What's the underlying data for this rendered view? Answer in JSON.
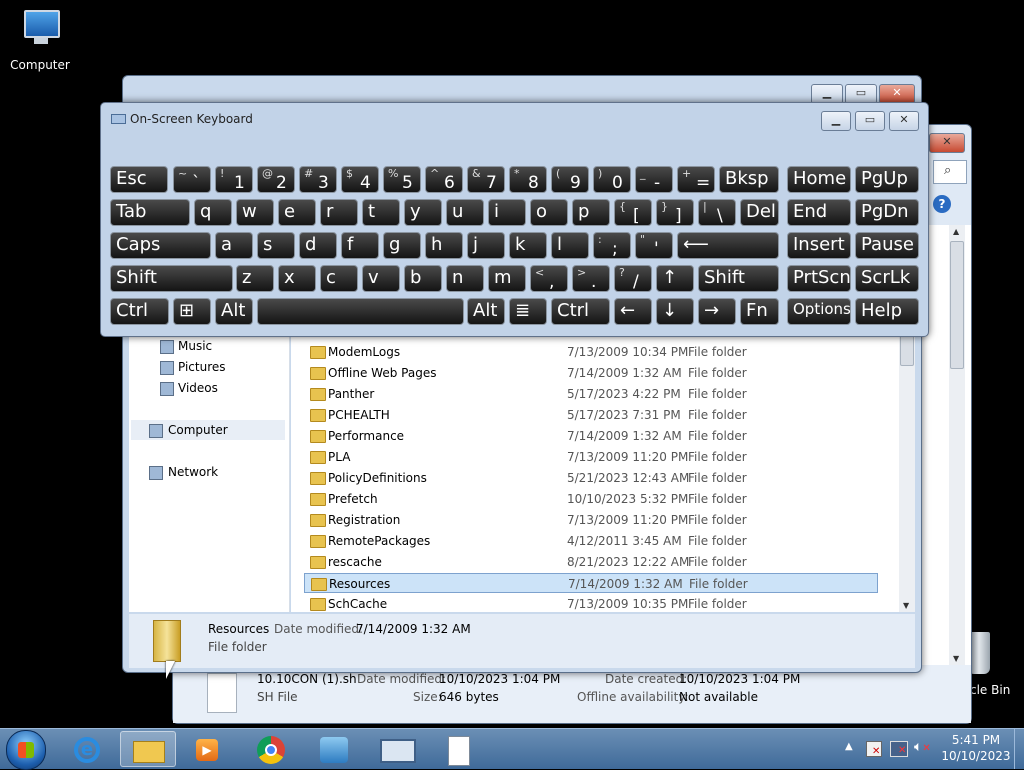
{
  "desktop": {
    "computer_label": "Computer",
    "recycle_label": "cle Bin"
  },
  "keyboard": {
    "title": "On-Screen Keyboard",
    "rows": [
      [
        {
          "k": "Esc"
        },
        {
          "s": "~",
          "m": "`"
        },
        {
          "s": "!",
          "m": "1"
        },
        {
          "s": "@",
          "m": "2"
        },
        {
          "s": "#",
          "m": "3"
        },
        {
          "s": "$",
          "m": "4"
        },
        {
          "s": "%",
          "m": "5"
        },
        {
          "s": "^",
          "m": "6"
        },
        {
          "s": "&",
          "m": "7"
        },
        {
          "s": "*",
          "m": "8"
        },
        {
          "s": "(",
          "m": "9"
        },
        {
          "s": ")",
          "m": "0"
        },
        {
          "s": "_",
          "m": "-"
        },
        {
          "s": "+",
          "m": "="
        },
        {
          "k": "Bksp"
        },
        {
          "k": "Home"
        },
        {
          "k": "PgUp"
        }
      ],
      [
        {
          "k": "Tab"
        },
        {
          "k": "q"
        },
        {
          "k": "w"
        },
        {
          "k": "e"
        },
        {
          "k": "r"
        },
        {
          "k": "t"
        },
        {
          "k": "y"
        },
        {
          "k": "u"
        },
        {
          "k": "i"
        },
        {
          "k": "o"
        },
        {
          "k": "p"
        },
        {
          "s": "{",
          "m": "["
        },
        {
          "s": "}",
          "m": "]"
        },
        {
          "s": "|",
          "m": "\\"
        },
        {
          "k": "Del"
        },
        {
          "k": "End"
        },
        {
          "k": "PgDn"
        }
      ],
      [
        {
          "k": "Caps"
        },
        {
          "k": "a"
        },
        {
          "k": "s"
        },
        {
          "k": "d"
        },
        {
          "k": "f"
        },
        {
          "k": "g"
        },
        {
          "k": "h"
        },
        {
          "k": "j"
        },
        {
          "k": "k"
        },
        {
          "k": "l"
        },
        {
          "s": ":",
          "m": ";"
        },
        {
          "s": "\"",
          "m": "'"
        },
        {
          "k": "⟵"
        },
        {
          "k": "Insert"
        },
        {
          "k": "Pause"
        }
      ],
      [
        {
          "k": "Shift"
        },
        {
          "k": "z"
        },
        {
          "k": "x"
        },
        {
          "k": "c"
        },
        {
          "k": "v"
        },
        {
          "k": "b"
        },
        {
          "k": "n"
        },
        {
          "k": "m"
        },
        {
          "s": "<",
          "m": ","
        },
        {
          "s": ">",
          "m": "."
        },
        {
          "s": "?",
          "m": "/"
        },
        {
          "k": "↑"
        },
        {
          "k": "Shift"
        },
        {
          "k": "PrtScn"
        },
        {
          "k": "ScrLk"
        }
      ],
      [
        {
          "k": "Ctrl"
        },
        {
          "k": "⊞"
        },
        {
          "k": "Alt"
        },
        {
          "k": ""
        },
        {
          "k": "Alt"
        },
        {
          "k": "≣"
        },
        {
          "k": "Ctrl"
        },
        {
          "k": "←"
        },
        {
          "k": "↓"
        },
        {
          "k": "→"
        },
        {
          "k": "Fn"
        },
        {
          "k": "Options"
        },
        {
          "k": "Help"
        }
      ]
    ]
  },
  "explorer": {
    "nav": [
      {
        "label": "Music",
        "icon": "music-icon"
      },
      {
        "label": "Pictures",
        "icon": "pictures-icon"
      },
      {
        "label": "Videos",
        "icon": "videos-icon"
      },
      {
        "label": "Computer",
        "icon": "computer-icon"
      },
      {
        "label": "Network",
        "icon": "network-icon"
      }
    ],
    "files": [
      {
        "name": "ModemLogs",
        "date": "7/13/2009 10:34 PM",
        "type": "File folder"
      },
      {
        "name": "Offline Web Pages",
        "date": "7/14/2009 1:32 AM",
        "type": "File folder"
      },
      {
        "name": "Panther",
        "date": "5/17/2023 4:22 PM",
        "type": "File folder"
      },
      {
        "name": "PCHEALTH",
        "date": "5/17/2023 7:31 PM",
        "type": "File folder"
      },
      {
        "name": "Performance",
        "date": "7/14/2009 1:32 AM",
        "type": "File folder"
      },
      {
        "name": "PLA",
        "date": "7/13/2009 11:20 PM",
        "type": "File folder"
      },
      {
        "name": "PolicyDefinitions",
        "date": "5/21/2023 12:43 AM",
        "type": "File folder"
      },
      {
        "name": "Prefetch",
        "date": "10/10/2023 5:32 PM",
        "type": "File folder"
      },
      {
        "name": "Registration",
        "date": "7/13/2009 11:20 PM",
        "type": "File folder"
      },
      {
        "name": "RemotePackages",
        "date": "4/12/2011 3:45 AM",
        "type": "File folder"
      },
      {
        "name": "rescache",
        "date": "8/21/2023 12:22 AM",
        "type": "File folder"
      },
      {
        "name": "Resources",
        "date": "7/14/2009 1:32 AM",
        "type": "File folder",
        "selected": true
      },
      {
        "name": "SchCache",
        "date": "7/13/2009 10:35 PM",
        "type": "File folder"
      }
    ],
    "details": {
      "name": "Resources",
      "date_label": "Date modified:",
      "date": "7/14/2009 1:32 AM",
      "type": "File folder"
    }
  },
  "back_window": {
    "details": {
      "name": "10.10CON (1).sh",
      "date_mod_label": "Date modified:",
      "date_mod": "10/10/2023 1:04 PM",
      "type": "SH File",
      "size_label": "Size:",
      "size": "646 bytes",
      "created_label": "Date created:",
      "created": "10/10/2023 1:04 PM",
      "offline_label": "Offline availability:",
      "offline": "Not available"
    }
  },
  "taskbar": {
    "time": "5:41 PM",
    "date": "10/10/2023",
    "pinned": [
      "start-orb",
      "internet-explorer-icon",
      "explorer-folder-icon",
      "media-player-icon",
      "chrome-icon",
      "control-panel-icon",
      "remote-desktop-icon",
      "notepad-icon"
    ]
  }
}
